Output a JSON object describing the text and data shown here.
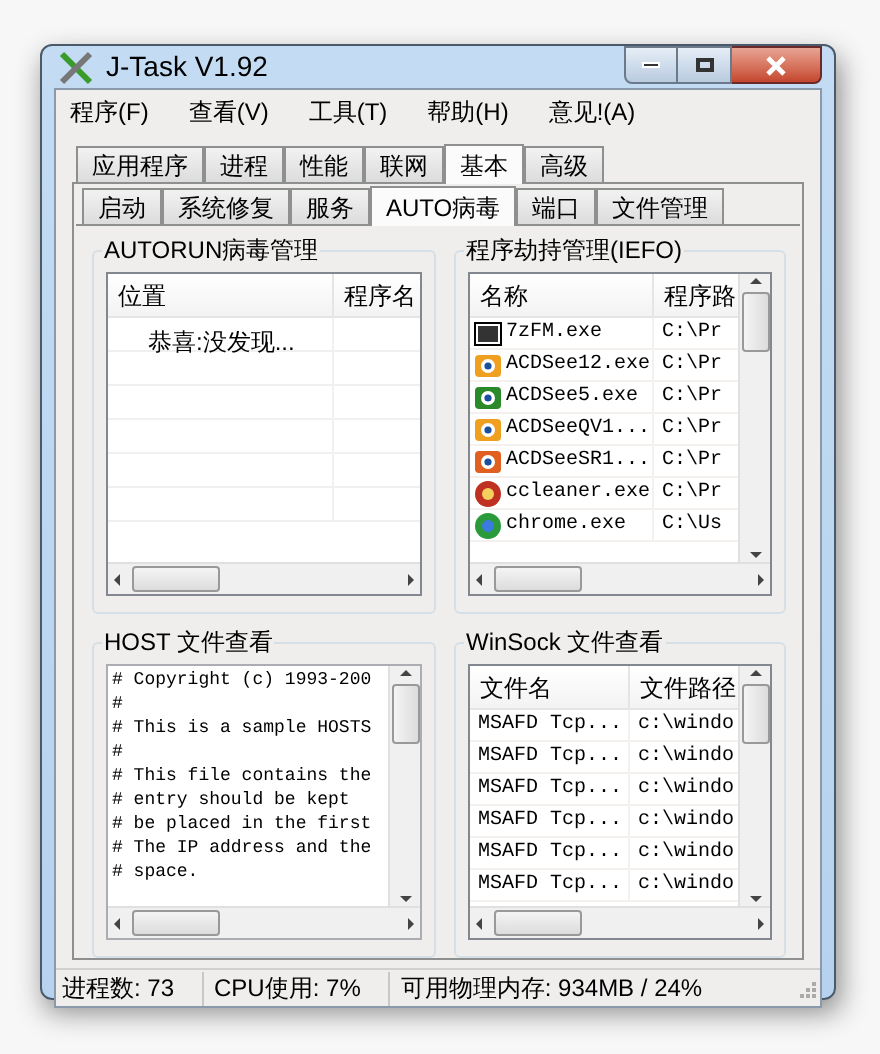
{
  "window": {
    "title": "J-Task V1.92"
  },
  "menu": [
    "程序(F)",
    "查看(V)",
    "工具(T)",
    "帮助(H)",
    "意见!(A)"
  ],
  "tabs": [
    {
      "label": "应用程序",
      "selected": false
    },
    {
      "label": "进程",
      "selected": false
    },
    {
      "label": "性能",
      "selected": false
    },
    {
      "label": "联网",
      "selected": false
    },
    {
      "label": "基本",
      "selected": true
    },
    {
      "label": "高级",
      "selected": false
    }
  ],
  "subtabs": [
    {
      "label": "启动",
      "selected": false
    },
    {
      "label": "系统修复",
      "selected": false
    },
    {
      "label": "服务",
      "selected": false
    },
    {
      "label": "AUTO病毒",
      "selected": true
    },
    {
      "label": "端口",
      "selected": false
    },
    {
      "label": "文件管理",
      "selected": false
    }
  ],
  "autorun": {
    "title": "AUTORUN病毒管理",
    "columns": [
      "位置",
      "程序名"
    ],
    "rows": [
      {
        "location": "恭喜:没发现..."
      }
    ]
  },
  "ifeo": {
    "title": "程序劫持管理(IEFO)",
    "columns": [
      "名称",
      "程序路"
    ],
    "rows": [
      {
        "name": "7zFM.exe",
        "path": "C:\\Pr"
      },
      {
        "name": "ACDSee12.exe",
        "path": "C:\\Pr"
      },
      {
        "name": "ACDSee5.exe",
        "path": "C:\\Pr"
      },
      {
        "name": "ACDSeeQV1...",
        "path": "C:\\Pr"
      },
      {
        "name": "ACDSeeSR1...",
        "path": "C:\\Pr"
      },
      {
        "name": "ccleaner.exe",
        "path": "C:\\Pr"
      },
      {
        "name": "chrome.exe",
        "path": "C:\\Us"
      }
    ]
  },
  "host": {
    "title": "HOST 文件查看",
    "lines": [
      "# Copyright (c) 1993-200",
      "#",
      "# This is a sample HOSTS",
      "#",
      "# This file contains the",
      "# entry should be kept",
      "# be placed in the first",
      "# The IP address and the",
      "# space."
    ]
  },
  "winsock": {
    "title": "WinSock 文件查看",
    "columns": [
      "文件名",
      "文件路径"
    ],
    "rows": [
      {
        "name": "MSAFD Tcp...",
        "path": "c:\\windo"
      },
      {
        "name": "MSAFD Tcp...",
        "path": "c:\\windo"
      },
      {
        "name": "MSAFD Tcp...",
        "path": "c:\\windo"
      },
      {
        "name": "MSAFD Tcp...",
        "path": "c:\\windo"
      },
      {
        "name": "MSAFD Tcp...",
        "path": "c:\\windo"
      },
      {
        "name": "MSAFD Tcp...",
        "path": "c:\\windo"
      }
    ]
  },
  "status_bar": [
    "进程数: 73",
    "CPU使用: 7%",
    "可用物理内存: 934MB / 24%"
  ]
}
